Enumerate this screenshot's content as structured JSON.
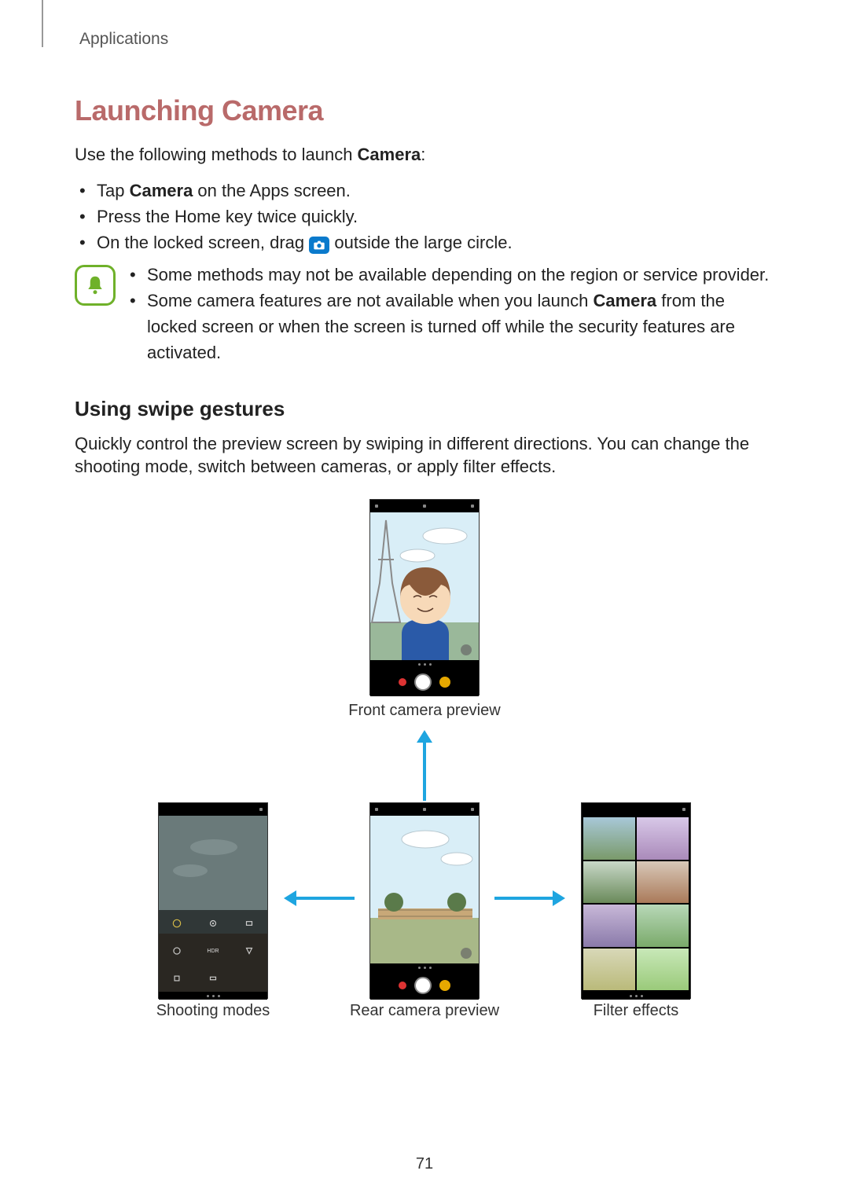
{
  "breadcrumb": "Applications",
  "heading": "Launching Camera",
  "intro_prefix": "Use the following methods to launch ",
  "intro_bold": "Camera",
  "intro_suffix": ":",
  "bullets": {
    "b1_prefix": "Tap ",
    "b1_bold": "Camera",
    "b1_suffix": " on the Apps screen.",
    "b2": "Press the Home key twice quickly.",
    "b3_prefix": "On the locked screen, drag ",
    "b3_suffix": " outside the large circle."
  },
  "notes": {
    "n1": "Some methods may not be available depending on the region or service provider.",
    "n2_prefix": "Some camera features are not available when you launch ",
    "n2_bold": "Camera",
    "n2_suffix": " from the locked screen or when the screen is turned off while the security features are activated."
  },
  "subheading": "Using swipe gestures",
  "paragraph": "Quickly control the preview screen by swiping in different directions. You can change the shooting mode, switch between cameras, or apply filter effects.",
  "captions": {
    "front": "Front camera preview",
    "modes": "Shooting modes",
    "rear": "Rear camera preview",
    "filters": "Filter effects"
  },
  "page_number": "71"
}
